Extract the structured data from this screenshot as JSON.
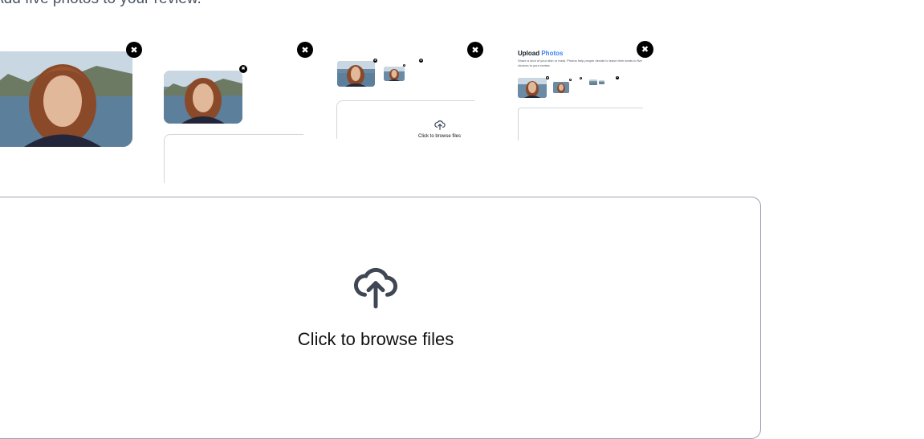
{
  "page": {
    "intro_text": "Add five photos to your review."
  },
  "thumbnails": {
    "remove_icon": "close-icon",
    "photo_icon": "portrait-photo"
  },
  "nested_preview": {
    "small_label": "Click to browse files",
    "title_prefix": "Upload",
    "title_accent": "Photos",
    "accent_color": "#3b82f6",
    "description": "Share a shot of your dish or meal. Photos help people decide to leave their seats to five choices to your review."
  },
  "upload": {
    "icon": "cloud-upload-icon",
    "label": "Click to browse files"
  }
}
